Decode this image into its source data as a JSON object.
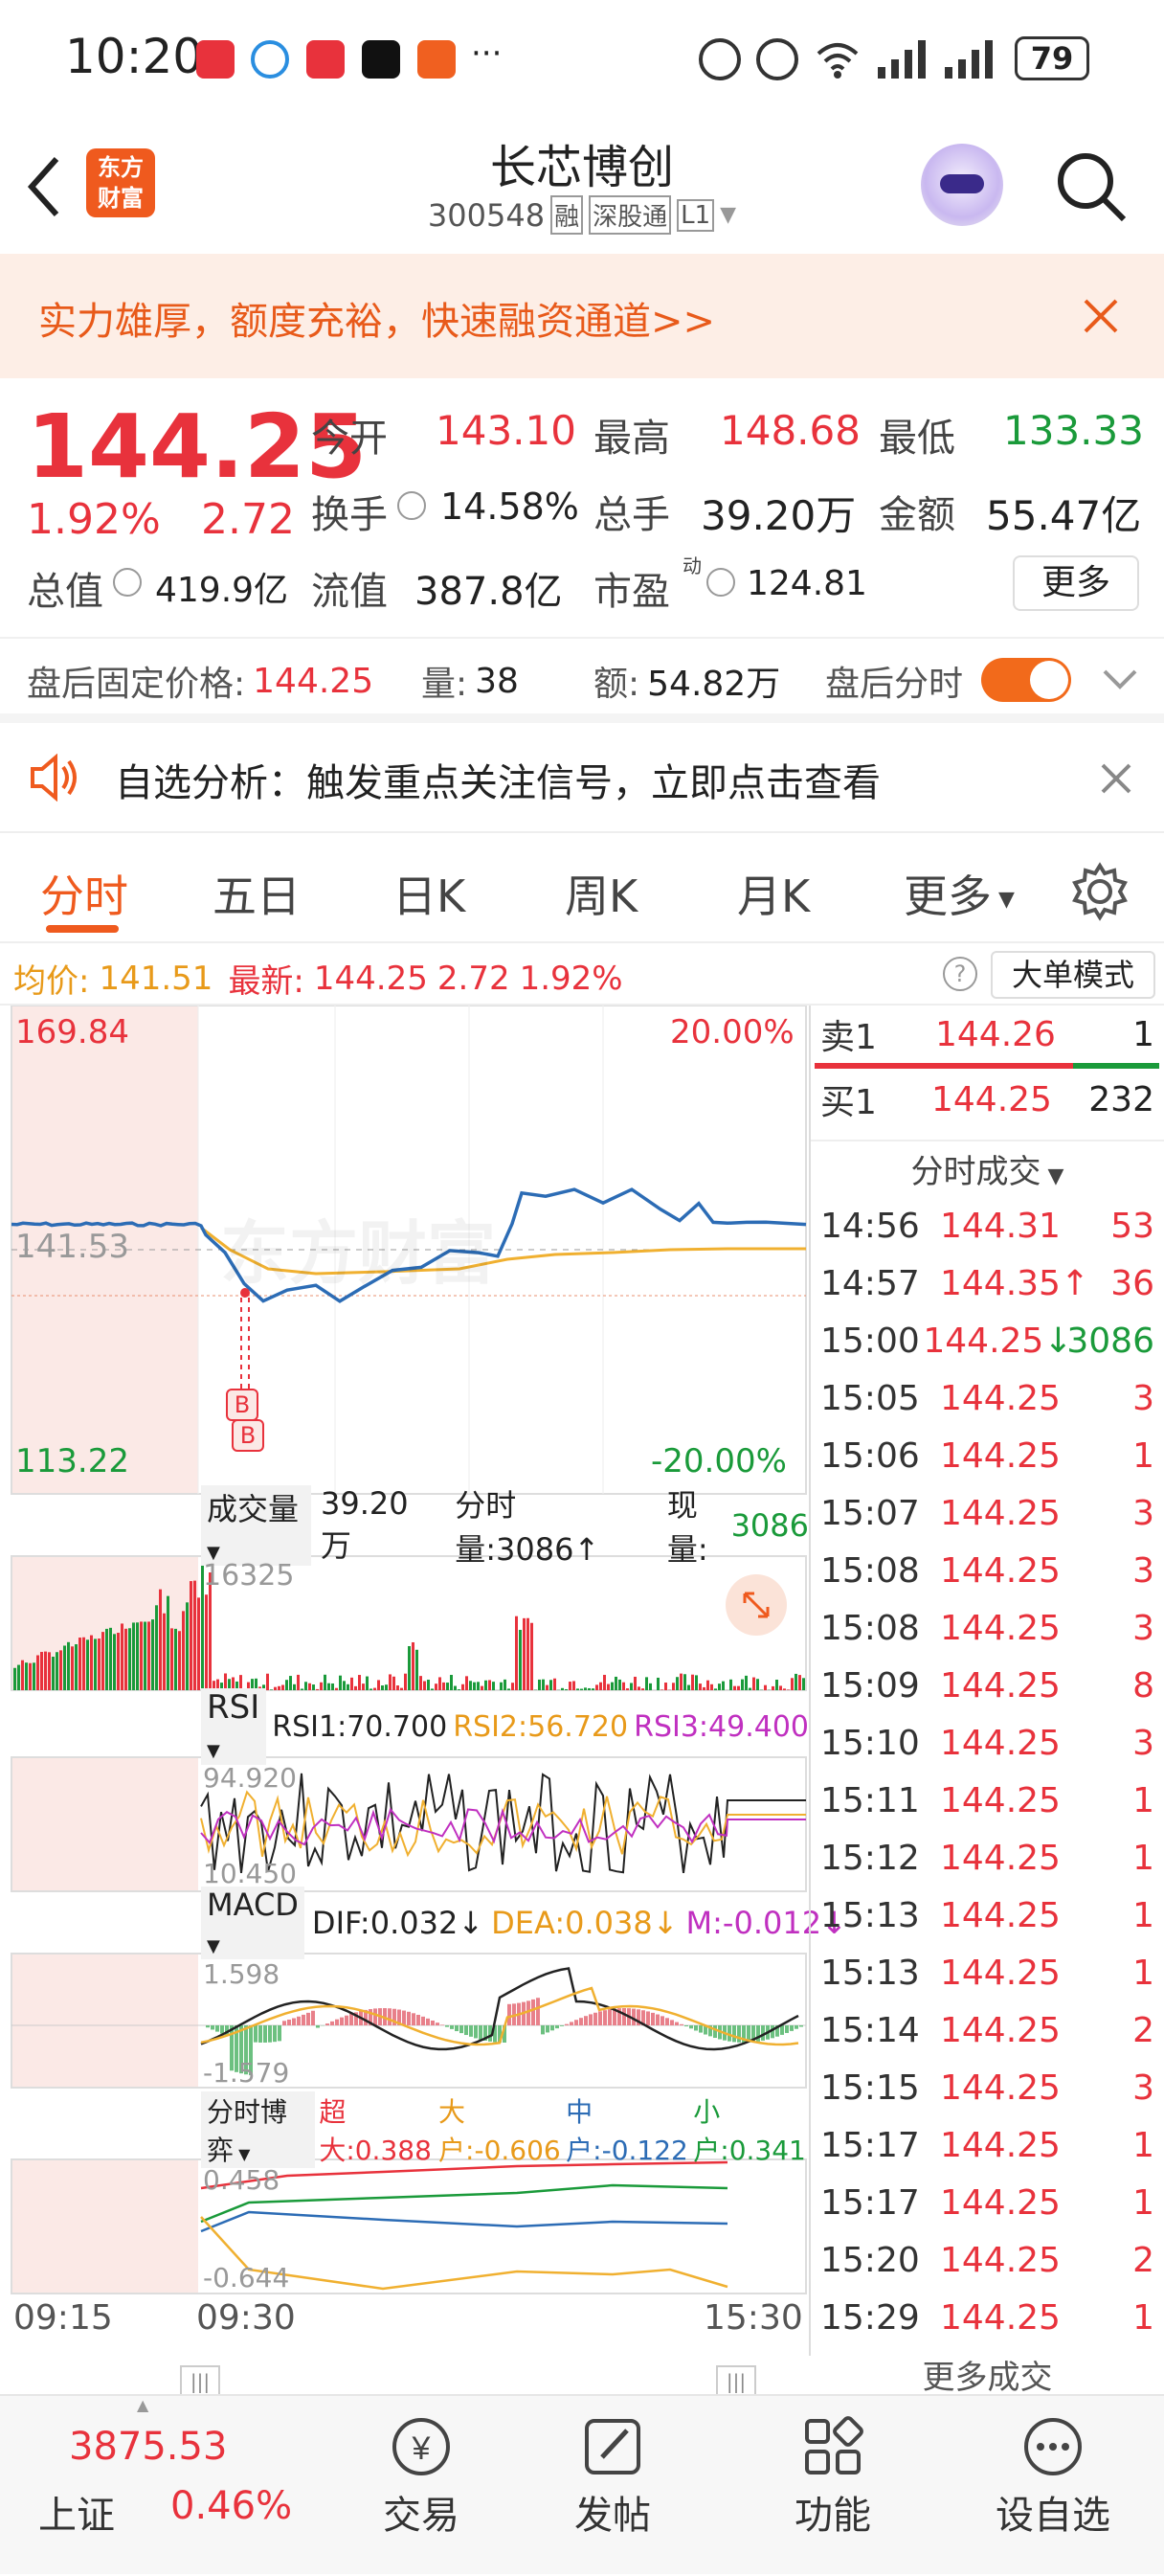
{
  "status_bar": {
    "time": "10:20",
    "battery": "79"
  },
  "header": {
    "title": "长芯博创",
    "code": "300548",
    "tag_rong": "融",
    "tag_sgt": "深股通",
    "tag_level": "L1",
    "logo_line1": "东方",
    "logo_line2": "财富"
  },
  "banner": {
    "text": "实力雄厚，额度充裕，快速融资通道>>"
  },
  "quote": {
    "price": "144.25",
    "change_pct": "1.92%",
    "change": "2.72",
    "open_label": "今开",
    "open": "143.10",
    "high_label": "最高",
    "high": "148.68",
    "low_label": "最低",
    "low": "133.33",
    "turnover_label": "换手",
    "turnover": "14.58%",
    "volume_label": "总手",
    "volume": "39.20万",
    "amount_label": "金额",
    "amount": "55.47亿",
    "mktcap_label": "总值",
    "mktcap": "419.9亿",
    "float_label": "流值",
    "float": "387.8亿",
    "pe_label": "市盈",
    "pe_sup": "动",
    "pe": "124.81",
    "more_label": "更多"
  },
  "after_hours": {
    "price_label": "盘后固定价格:",
    "price": "144.25",
    "vol_label": "量:",
    "vol": "38",
    "amt_label": "额:",
    "amt": "54.82万",
    "toggle_label": "盘后分时"
  },
  "notice": {
    "text": "自选分析：触发重点关注信号，立即点击查看"
  },
  "tabs": [
    "分时",
    "五日",
    "日K",
    "周K",
    "月K",
    "更多"
  ],
  "price_bar": {
    "avg_label": "均价:",
    "avg": "141.51",
    "latest_label": "最新:",
    "latest": "144.25",
    "chg": "2.72",
    "pct": "1.92%",
    "mode_label": "大单模式"
  },
  "chart": {
    "y_top": "169.84",
    "y_mid": "141.53",
    "y_bottom": "113.22",
    "pct_top": "20.00%",
    "pct_bottom": "-20.00%",
    "watermark": "东方财富",
    "vol_label": "成交量",
    "vol_total": "39.20万",
    "vol_tick": "分时量:3086↑",
    "vol_now_label": "现量:",
    "vol_now": "3086",
    "vol_max": "16325",
    "rsi_label": "RSI",
    "rsi1": "RSI1:70.700",
    "rsi2": "RSI2:56.720",
    "rsi3": "RSI3:49.400",
    "rsi_top": "94.920",
    "rsi_bottom": "10.450",
    "macd_label": "MACD",
    "dif": "DIF:0.032↓",
    "dea": "DEA:0.038↓",
    "m": "M:-0.012↓",
    "macd_top": "1.598",
    "macd_bottom": "-1.579",
    "game_label": "分时博弈",
    "g1": "超大:0.388",
    "g2": "大户:-0.606",
    "g3": "中户:-0.122",
    "g4": "小户:0.341",
    "game_top": "0.458",
    "game_bottom": "-0.644",
    "t1": "09:15",
    "t2": "09:30",
    "t3": "15:30",
    "bs_label": "B",
    "colors": {
      "price_line": "#2c6cb5",
      "avg_line": "#f0b030",
      "up": "#e8323c",
      "down": "#1a9a3a"
    }
  },
  "orderbook": {
    "sell_label": "卖1",
    "sell_price": "144.26",
    "sell_vol": "1",
    "buy_label": "买1",
    "buy_price": "144.25",
    "buy_vol": "232",
    "ticks_label": "分时成交"
  },
  "ticks": [
    {
      "t": "14:56",
      "p": "144.31",
      "v": "53"
    },
    {
      "t": "14:57",
      "p": "144.35↑",
      "v": "36"
    },
    {
      "t": "15:00",
      "p": "144.25↓",
      "v": "3086"
    },
    {
      "t": "15:05",
      "p": "144.25",
      "v": "3"
    },
    {
      "t": "15:06",
      "p": "144.25",
      "v": "1"
    },
    {
      "t": "15:07",
      "p": "144.25",
      "v": "3"
    },
    {
      "t": "15:08",
      "p": "144.25",
      "v": "3"
    },
    {
      "t": "15:08",
      "p": "144.25",
      "v": "3"
    },
    {
      "t": "15:09",
      "p": "144.25",
      "v": "8"
    },
    {
      "t": "15:10",
      "p": "144.25",
      "v": "3"
    },
    {
      "t": "15:11",
      "p": "144.25",
      "v": "1"
    },
    {
      "t": "15:12",
      "p": "144.25",
      "v": "1"
    },
    {
      "t": "15:13",
      "p": "144.25",
      "v": "1"
    },
    {
      "t": "15:13",
      "p": "144.25",
      "v": "1"
    },
    {
      "t": "15:14",
      "p": "144.25",
      "v": "2"
    },
    {
      "t": "15:15",
      "p": "144.25",
      "v": "3"
    },
    {
      "t": "15:17",
      "p": "144.25",
      "v": "1"
    },
    {
      "t": "15:17",
      "p": "144.25",
      "v": "1"
    },
    {
      "t": "15:20",
      "p": "144.25",
      "v": "2"
    },
    {
      "t": "15:29",
      "p": "144.25",
      "v": "1"
    }
  ],
  "more_ticks": "更多成交",
  "bottom": {
    "index_value": "3875.53",
    "index_name": "上证",
    "index_pct": "0.46%",
    "nav": [
      "交易",
      "发帖",
      "功能",
      "设自选"
    ]
  }
}
